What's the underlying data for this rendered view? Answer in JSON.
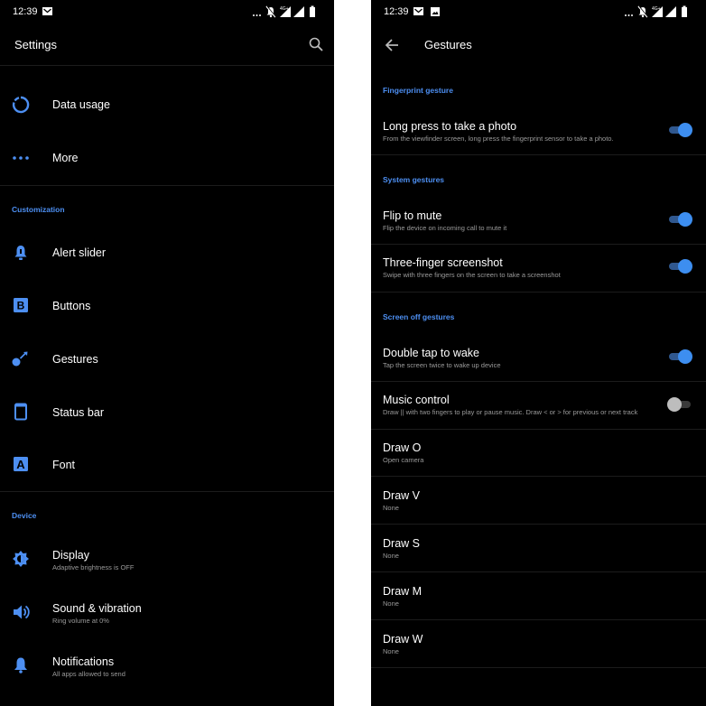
{
  "accent": "#4d8ff2",
  "left": {
    "status": {
      "time": "12:39"
    },
    "title": "Settings",
    "items_top": [
      {
        "label": "Data usage",
        "icon": "data-usage-icon"
      },
      {
        "label": "More",
        "icon": "more-dots-icon"
      }
    ],
    "customization_header": "Customization",
    "customization_items": [
      {
        "label": "Alert slider",
        "icon": "alert-slider-icon"
      },
      {
        "label": "Buttons",
        "icon": "buttons-icon"
      },
      {
        "label": "Gestures",
        "icon": "gestures-icon"
      },
      {
        "label": "Status bar",
        "icon": "status-bar-icon"
      },
      {
        "label": "Font",
        "icon": "font-icon"
      }
    ],
    "device_header": "Device",
    "device_items": [
      {
        "label": "Display",
        "sub": "Adaptive brightness is OFF",
        "icon": "display-icon"
      },
      {
        "label": "Sound & vibration",
        "sub": "Ring volume at 0%",
        "icon": "sound-icon"
      },
      {
        "label": "Notifications",
        "sub": "All apps allowed to send",
        "icon": "notifications-icon"
      }
    ]
  },
  "right": {
    "status": {
      "time": "12:39"
    },
    "title": "Gestures",
    "fingerprint_header": "Fingerprint gesture",
    "system_header": "System gestures",
    "screenoff_header": "Screen off gestures",
    "gestures": [
      {
        "label": "Long press to take a photo",
        "sub": "From the viewfinder screen, long press the fingerprint sensor to take a photo.",
        "enabled": true
      },
      {
        "label": "Flip to mute",
        "sub": "Flip the device on incoming call to mute it",
        "enabled": true
      },
      {
        "label": "Three-finger screenshot",
        "sub": "Swipe with three fingers on the screen to take a screenshot",
        "enabled": true
      },
      {
        "label": "Double tap to wake",
        "sub": "Tap the screen twice to wake up device",
        "enabled": true
      },
      {
        "label": "Music control",
        "sub": "Draw || with two fingers to play or pause music. Draw < or > for previous or next track",
        "enabled": false
      },
      {
        "label": "Draw O",
        "sub": "Open camera"
      },
      {
        "label": "Draw V",
        "sub": "None"
      },
      {
        "label": "Draw S",
        "sub": "None"
      },
      {
        "label": "Draw M",
        "sub": "None"
      },
      {
        "label": "Draw W",
        "sub": "None"
      }
    ]
  }
}
